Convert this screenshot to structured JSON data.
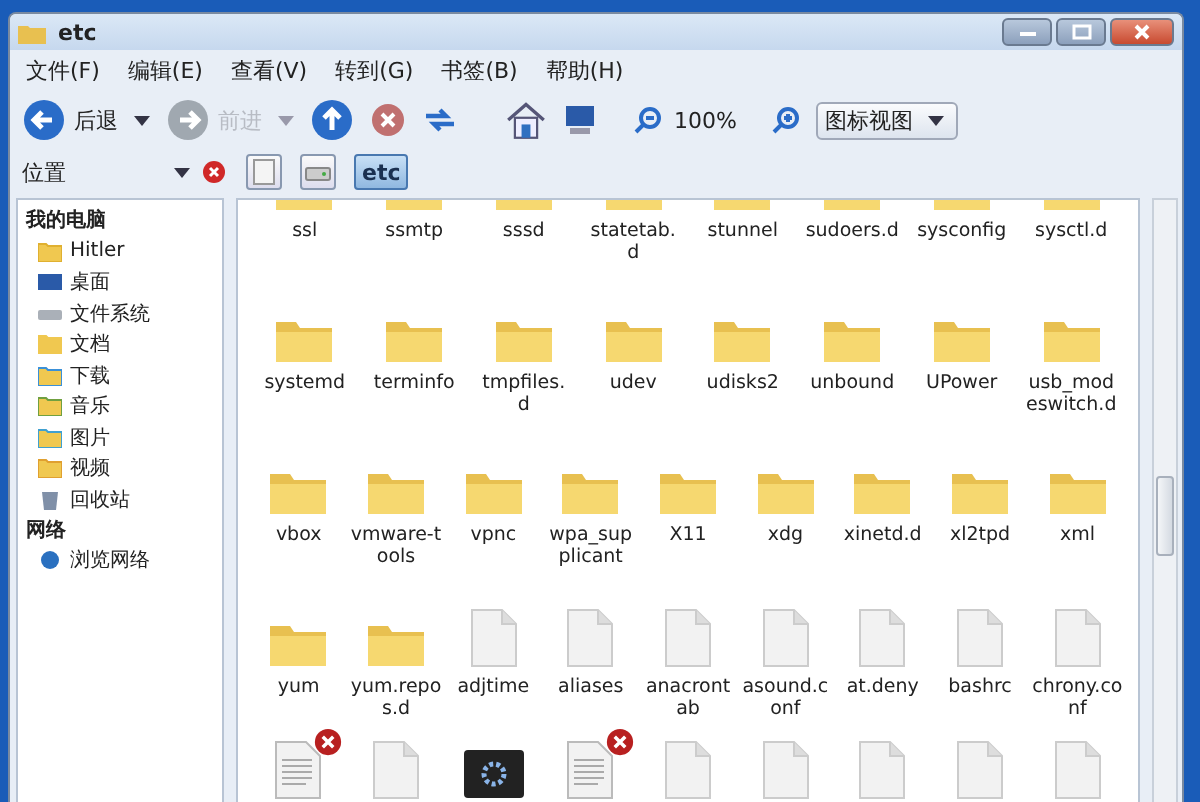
{
  "window": {
    "title": "etc"
  },
  "menu": [
    "文件(F)",
    "编辑(E)",
    "查看(V)",
    "转到(G)",
    "书签(B)",
    "帮助(H)"
  ],
  "toolbar": {
    "back": {
      "label": "后退",
      "disabled": false
    },
    "forward": {
      "label": "前进",
      "disabled": true
    },
    "zoom": "100%",
    "view_mode": "图标视图"
  },
  "location": {
    "label": "位置",
    "path": [
      {
        "kind": "root",
        "selected": false
      },
      {
        "kind": "drive",
        "selected": false
      },
      {
        "kind": "folder",
        "label": "etc",
        "selected": true
      }
    ]
  },
  "sidebar": {
    "sections": [
      {
        "title": "我的电脑",
        "items": [
          {
            "label": "Hitler",
            "kind": "home"
          },
          {
            "label": "桌面",
            "kind": "desktop"
          },
          {
            "label": "文件系统",
            "kind": "drive"
          },
          {
            "label": "文档",
            "kind": "documents"
          },
          {
            "label": "下载",
            "kind": "downloads"
          },
          {
            "label": "音乐",
            "kind": "music"
          },
          {
            "label": "图片",
            "kind": "pictures"
          },
          {
            "label": "视频",
            "kind": "videos"
          },
          {
            "label": "回收站",
            "kind": "trash"
          }
        ]
      },
      {
        "title": "网络",
        "items": [
          {
            "label": "浏览网络",
            "kind": "network"
          }
        ]
      }
    ]
  },
  "files": {
    "rows": [
      [
        {
          "name": "ssl",
          "kind": "folder",
          "broken": false
        },
        {
          "name": "ssmtp",
          "kind": "folder",
          "broken": false
        },
        {
          "name": "sssd",
          "kind": "folder",
          "broken": false
        },
        {
          "name": "statetab.d",
          "kind": "folder",
          "broken": false
        },
        {
          "name": "stunnel",
          "kind": "folder",
          "broken": false
        },
        {
          "name": "sudoers.d",
          "kind": "folder",
          "broken": false
        },
        {
          "name": "sysconfig",
          "kind": "folder",
          "broken": false
        },
        {
          "name": "sysctl.d",
          "kind": "folder",
          "broken": false
        }
      ],
      [
        {
          "name": "systemd",
          "kind": "folder",
          "broken": false
        },
        {
          "name": "terminfo",
          "kind": "folder",
          "broken": false
        },
        {
          "name": "tmpfiles.d",
          "kind": "folder",
          "broken": false
        },
        {
          "name": "udev",
          "kind": "folder",
          "broken": false
        },
        {
          "name": "udisks2",
          "kind": "folder",
          "broken": false
        },
        {
          "name": "unbound",
          "kind": "folder",
          "broken": false
        },
        {
          "name": "UPower",
          "kind": "folder",
          "broken": false
        },
        {
          "name": "usb_modeswitch.d",
          "kind": "folder",
          "broken": false
        }
      ],
      [
        {
          "name": "vbox",
          "kind": "folder",
          "broken": false
        },
        {
          "name": "vmware-tools",
          "kind": "folder",
          "broken": false
        },
        {
          "name": "vpnc",
          "kind": "folder",
          "broken": false
        },
        {
          "name": "wpa_supplicant",
          "kind": "folder",
          "broken": false
        },
        {
          "name": "X11",
          "kind": "folder",
          "broken": false
        },
        {
          "name": "xdg",
          "kind": "folder",
          "broken": false
        },
        {
          "name": "xinetd.d",
          "kind": "folder",
          "broken": false
        },
        {
          "name": "xl2tpd",
          "kind": "folder",
          "broken": false
        },
        {
          "name": "xml",
          "kind": "folder",
          "broken": false
        }
      ],
      [
        {
          "name": "yum",
          "kind": "folder",
          "broken": false
        },
        {
          "name": "yum.repos.d",
          "kind": "folder",
          "broken": false
        },
        {
          "name": "adjtime",
          "kind": "file",
          "broken": false
        },
        {
          "name": "aliases",
          "kind": "file",
          "broken": false
        },
        {
          "name": "anacrontab",
          "kind": "file",
          "broken": false
        },
        {
          "name": "asound.conf",
          "kind": "file",
          "broken": false
        },
        {
          "name": "at.deny",
          "kind": "file",
          "broken": false
        },
        {
          "name": "bashrc",
          "kind": "file",
          "broken": false
        },
        {
          "name": "chrony.conf",
          "kind": "file",
          "broken": false
        }
      ],
      [
        {
          "kind": "textfile",
          "broken": true
        },
        {
          "kind": "file",
          "broken": false
        },
        {
          "kind": "terminal",
          "broken": false
        },
        {
          "kind": "textfile",
          "broken": true
        },
        {
          "kind": "file",
          "broken": false
        },
        {
          "kind": "file",
          "broken": false
        },
        {
          "kind": "file",
          "broken": false
        },
        {
          "kind": "file",
          "broken": false
        },
        {
          "kind": "file",
          "broken": false
        }
      ]
    ]
  }
}
